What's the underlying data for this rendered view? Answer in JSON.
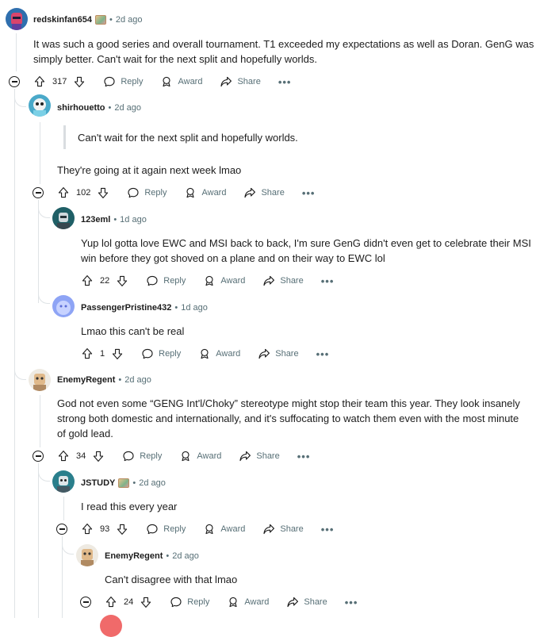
{
  "comments": [
    {
      "id": "c1",
      "author": "redskinfan654",
      "has_flair": true,
      "time": "2d ago",
      "lines": [
        "It was such a good series and overall tournament. T1 exceeded my expectations as well as Doran. GenG was",
        "simply better. Can't wait for the next split and hopefully worlds."
      ],
      "votes": "317"
    },
    {
      "id": "c2",
      "author": "shirhouetto",
      "has_flair": false,
      "time": "2d ago",
      "quote": "Can't wait for the next split and hopefully worlds.",
      "lines": [
        "They're going at it again next week lmao"
      ],
      "votes": "102"
    },
    {
      "id": "c3",
      "author": "123eml",
      "has_flair": false,
      "time": "1d ago",
      "lines": [
        "Yup lol gotta love EWC and MSI back to back, I'm sure GenG didn't even get to celebrate their MSI",
        "win before they got shoved on a plane and on their way to EWC lol"
      ],
      "votes": "22"
    },
    {
      "id": "c4",
      "author": "PassengerPristine432",
      "has_flair": false,
      "time": "1d ago",
      "lines": [
        "Lmao this can't be real"
      ],
      "votes": "1"
    },
    {
      "id": "c5",
      "author": "EnemyRegent",
      "has_flair": false,
      "time": "2d ago",
      "lines": [
        "God not even some “GENG Int'l/Choky” stereotype might stop their team this year. They look insanely",
        "strong both domestic and internationally, and it's suffocating to watch them even with the most minute",
        "of gold lead."
      ],
      "votes": "34"
    },
    {
      "id": "c6",
      "author": "JSTUDY",
      "has_flair": true,
      "time": "2d ago",
      "lines": [
        "I read this every year"
      ],
      "votes": "93"
    },
    {
      "id": "c7",
      "author": "EnemyRegent",
      "has_flair": false,
      "time": "2d ago",
      "lines": [
        "Can't disagree with that lmao"
      ],
      "votes": "24"
    }
  ],
  "labels": {
    "reply": "Reply",
    "award": "Award",
    "share": "Share",
    "more": "•••",
    "separator": "•"
  },
  "colors": {
    "text": "#1c1c1c",
    "meta": "#576f76",
    "thread_line": "#dfe3e6"
  }
}
